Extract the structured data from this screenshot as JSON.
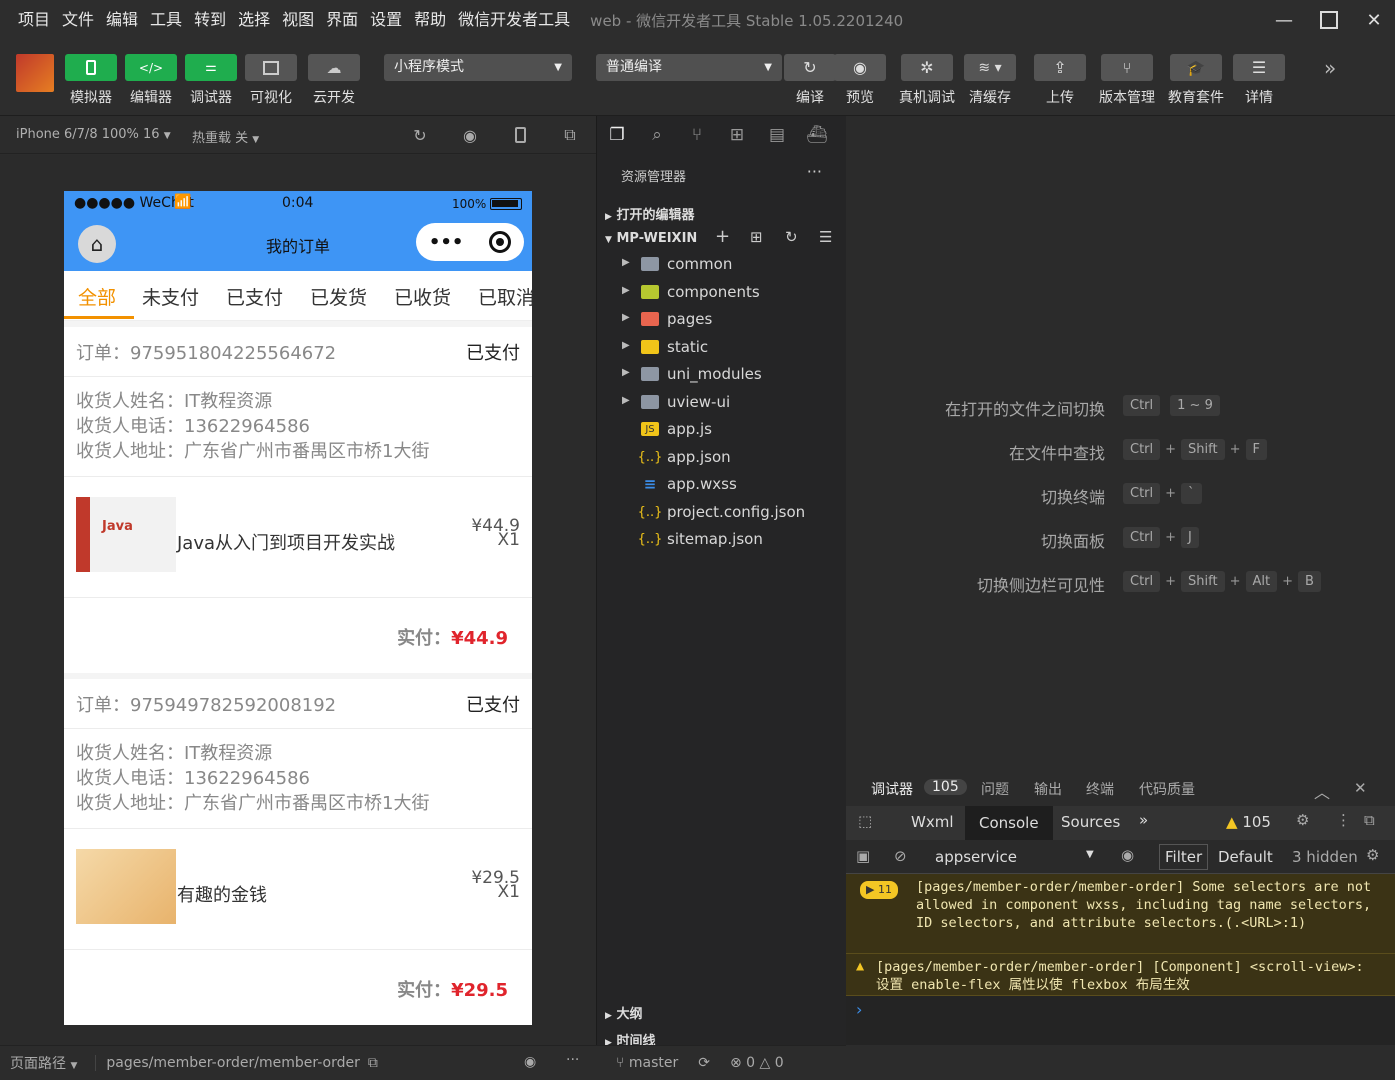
{
  "titlebar": {
    "menus": [
      "项目",
      "文件",
      "编辑",
      "工具",
      "转到",
      "选择",
      "视图",
      "界面",
      "设置",
      "帮助",
      "微信开发者工具"
    ],
    "title": "web - 微信开发者工具 Stable 1.05.2201240"
  },
  "toolbar": {
    "simulator": "模拟器",
    "editor": "编辑器",
    "debugger": "调试器",
    "visual": "可视化",
    "cloud": "云开发",
    "mode": "小程序模式",
    "compile_mode": "普通编译",
    "compile": "编译",
    "preview": "预览",
    "remote_debug": "真机调试",
    "clear_cache": "清缓存",
    "upload": "上传",
    "version": "版本管理",
    "edu": "教育套件",
    "details": "详情"
  },
  "simhead": {
    "device": "iPhone 6/7/8 100% 16",
    "hot_reload": "热重载 关"
  },
  "phone": {
    "carrier": "●●●●● WeChat",
    "time": "0:04",
    "battery": "100%",
    "nav_title": "我的订单",
    "tabs": [
      "全部",
      "未支付",
      "已支付",
      "已发货",
      "已收货",
      "已取消"
    ],
    "orders": [
      {
        "order_no": "订单：975951804225564672",
        "status": "已支付",
        "name": "收货人姓名：IT教程资源",
        "phone": "收货人电话：13622964586",
        "address": "收货人地址：广东省广州市番禺区市桥1大街",
        "item_name": "Java从入门到项目开发实战",
        "item_price": "¥44.9",
        "item_qty": "X1",
        "pay_label": "实付：",
        "pay_amount": "¥44.9"
      },
      {
        "order_no": "订单：975949782592008192",
        "status": "已支付",
        "name": "收货人姓名：IT教程资源",
        "phone": "收货人电话：13622964586",
        "address": "收货人地址：广东省广州市番禺区市桥1大街",
        "item_name": "有趣的金钱",
        "item_price": "¥29.5",
        "item_qty": "X1",
        "pay_label": "实付：",
        "pay_amount": "¥29.5"
      }
    ]
  },
  "simfoot": {
    "path_label": "页面路径",
    "path": "pages/member-order/member-order"
  },
  "explorer": {
    "title": "资源管理器",
    "open_editors": "打开的编辑器",
    "project": "MP-WEIXIN",
    "files": [
      "common",
      "components",
      "pages",
      "static",
      "uni_modules",
      "uview-ui",
      "app.js",
      "app.json",
      "app.wxss",
      "project.config.json",
      "sitemap.json"
    ],
    "outline": "大纲",
    "timeline": "时间线",
    "branch": "master",
    "errors": "0",
    "warnings": "0"
  },
  "shortcuts": [
    {
      "label": "在打开的文件之间切换",
      "keys": [
        "Ctrl",
        "1 ~ 9"
      ]
    },
    {
      "label": "在文件中查找",
      "keys": [
        "Ctrl",
        "Shift",
        "F"
      ]
    },
    {
      "label": "切换终端",
      "keys": [
        "Ctrl",
        "`"
      ]
    },
    {
      "label": "切换面板",
      "keys": [
        "Ctrl",
        "J"
      ]
    },
    {
      "label": "切换侧边栏可见性",
      "keys": [
        "Ctrl",
        "Shift",
        "Alt",
        "B"
      ]
    }
  ],
  "debugger": {
    "tabs": [
      "调试器",
      "问题",
      "输出",
      "终端",
      "代码质量"
    ],
    "badge": "105",
    "tools": [
      "Wxml",
      "Console",
      "Sources"
    ],
    "warn_count": "105",
    "context": "appservice",
    "filter_placeholder": "Filter",
    "level": "Default",
    "hidden": "3 hidden",
    "msg1_count": "11",
    "msg1": "[pages/member-order/member-order] Some selectors are not allowed in component wxss, including tag name selectors, ID selectors, and attribute selectors.(.<URL>:1)",
    "msg2": "[pages/member-order/member-order] [Component] <scroll-view>: 设置 enable-flex 属性以使 flexbox 布局生效"
  },
  "colors": {
    "accent_green": "#1fad4e",
    "wechat_blue": "#3e95f5",
    "tab_active": "#f29100",
    "price_red": "#e0242c"
  }
}
